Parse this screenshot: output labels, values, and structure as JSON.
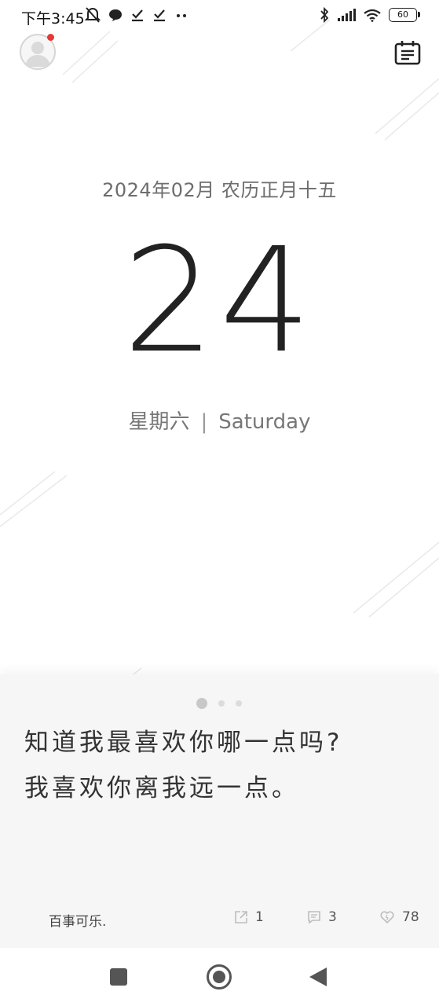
{
  "status_bar": {
    "time": "下午3:45",
    "battery": "60"
  },
  "calendar": {
    "date_line": "2024年02月 农历正月十五",
    "day": "24",
    "weekday_cn": "星期六",
    "separator": "|",
    "weekday_en": "Saturday"
  },
  "quote": {
    "line1": "知道我最喜欢你哪一点吗?",
    "line2": "我喜欢你离我远一点。",
    "author": "百事可乐.",
    "share_count": "1",
    "comment_count": "3",
    "like_count": "78",
    "page_count": 3,
    "active_page": 1
  },
  "icons": {
    "avatar": "user-avatar-icon",
    "calendar": "calendar-list-icon",
    "share": "share-icon",
    "comment": "comment-icon",
    "like": "heart-icon"
  },
  "colors": {
    "notification_dot": "#e53935",
    "quote_background": "#f6f6f6"
  }
}
